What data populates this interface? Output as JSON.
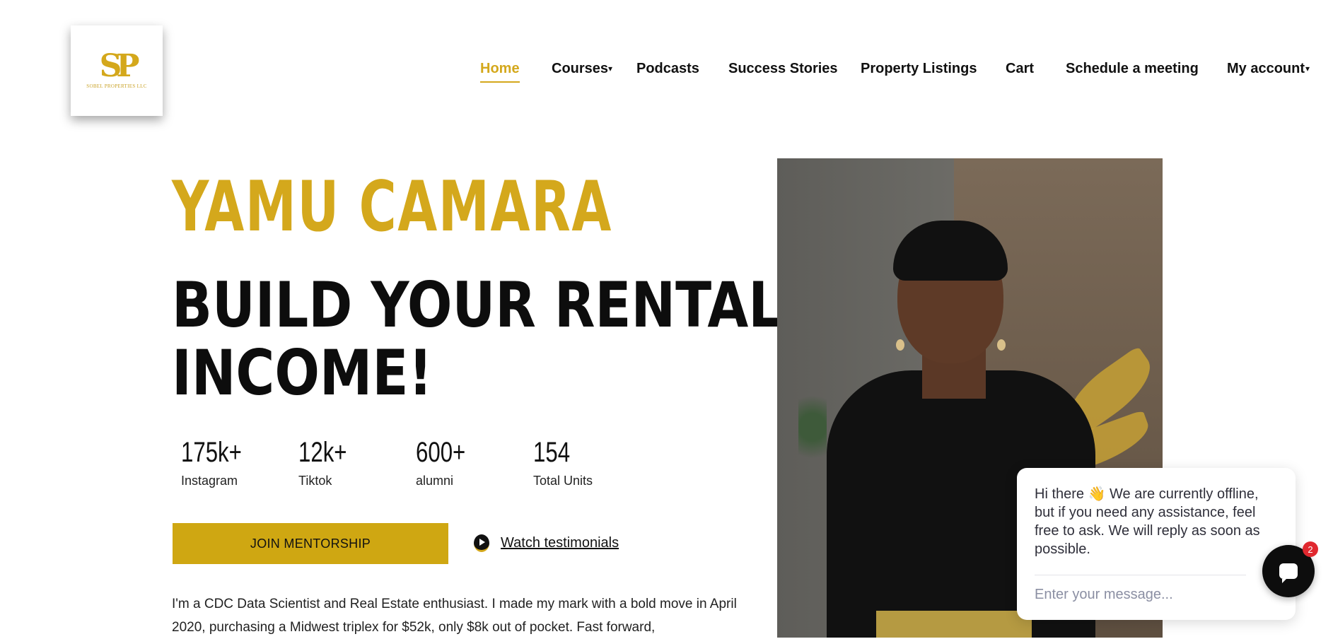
{
  "logo": {
    "mark": "SP",
    "text": "SOBEL PROPERTIES LLC"
  },
  "nav": {
    "items": [
      {
        "label": "Home",
        "active": true
      },
      {
        "label": "Courses",
        "dropdown": true
      },
      {
        "label": "Podcasts"
      },
      {
        "label": "Success Stories"
      },
      {
        "label": "Property Listings"
      },
      {
        "label": "Cart"
      },
      {
        "label": "Schedule a meeting"
      },
      {
        "label": "My account",
        "dropdown": true
      }
    ],
    "caret": "▾"
  },
  "hero": {
    "name": "YAMU CAMARA",
    "headline_line1": "BUILD YOUR RENTAL",
    "headline_line2": "INCOME!",
    "stats": [
      {
        "value": "175k+",
        "label": "Instagram"
      },
      {
        "value": "12k+",
        "label": "Tiktok"
      },
      {
        "value": "600+",
        "label": "alumni"
      },
      {
        "value": "154",
        "label": "Total Units"
      }
    ],
    "cta_join": "JOIN MENTORSHIP",
    "cta_watch": "Watch testimonials",
    "bio": "I'm a CDC Data Scientist and Real Estate enthusiast. I made my mark with a bold move in April 2020, purchasing a Midwest triplex for $52k, only $8k out of pocket. Fast forward,"
  },
  "chat": {
    "message": "Hi there 👋 We are currently offline, but if you need any assistance, feel free to ask. We will reply as soon as possible.",
    "input_placeholder": "Enter your message...",
    "badge_count": "2"
  },
  "colors": {
    "accent": "#d4a81c",
    "button": "#cfa712",
    "text": "#111111"
  }
}
